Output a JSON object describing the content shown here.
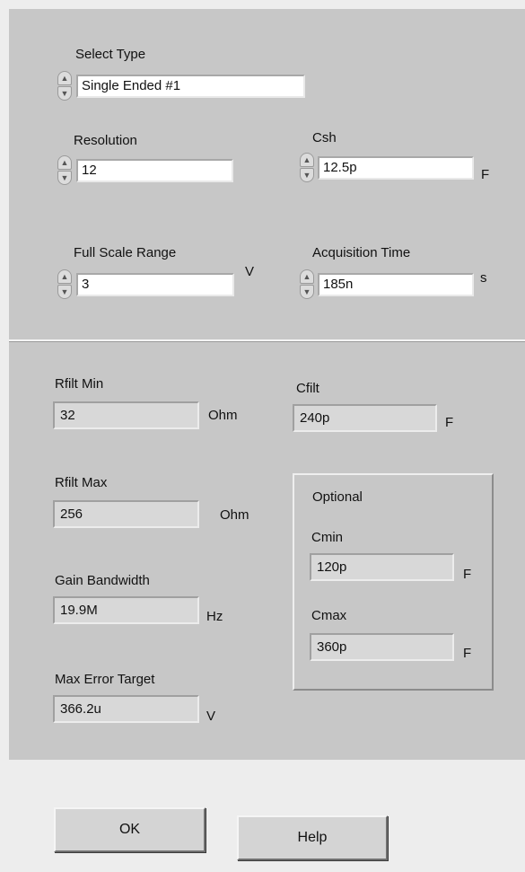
{
  "top_panel": {
    "select_type": {
      "label": "Select Type",
      "value": "Single Ended #1"
    },
    "resolution": {
      "label": "Resolution",
      "value": "12"
    },
    "csh": {
      "label": "Csh",
      "value": "12.5p",
      "unit": "F"
    },
    "full_scale_range": {
      "label": "Full Scale Range",
      "value": "3",
      "unit": "V"
    },
    "acquisition_time": {
      "label": "Acquisition Time",
      "value": "185n",
      "unit": "s"
    }
  },
  "bottom_panel": {
    "rfilt_min": {
      "label": "Rfilt Min",
      "value": "32",
      "unit": "Ohm"
    },
    "cfilt": {
      "label": "Cfilt",
      "value": "240p",
      "unit": "F"
    },
    "rfilt_max": {
      "label": "Rfilt Max",
      "value": "256",
      "unit": "Ohm"
    },
    "gain_bandwidth": {
      "label": "Gain Bandwidth",
      "value": "19.9M",
      "unit": "Hz"
    },
    "max_error_target": {
      "label": "Max Error Target",
      "value": "366.2u",
      "unit": "V"
    },
    "optional": {
      "title": "Optional",
      "cmin": {
        "label": "Cmin",
        "value": "120p",
        "unit": "F"
      },
      "cmax": {
        "label": "Cmax",
        "value": "360p",
        "unit": "F"
      }
    }
  },
  "buttons": {
    "ok": "OK",
    "help": "Help"
  }
}
